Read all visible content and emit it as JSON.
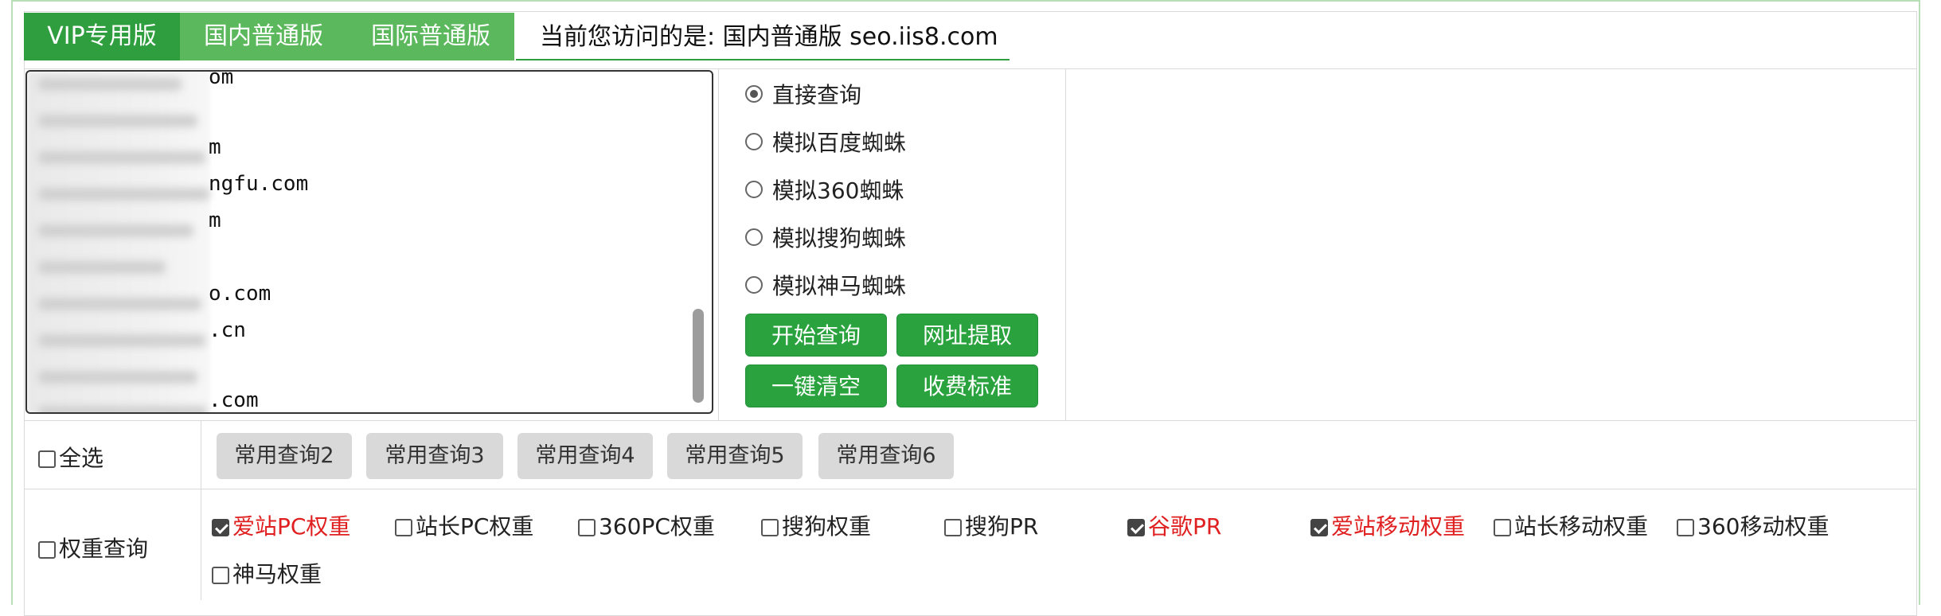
{
  "tabs": [
    {
      "label": "VIP专用版",
      "active": true
    },
    {
      "label": "国内普通版",
      "active": false
    },
    {
      "label": "国际普通版",
      "active": false
    }
  ],
  "visit_text": "当前您访问的是: 国内普通版 seo.iis8.com",
  "url_lines": [
    {
      "text": "om"
    },
    {
      "text": ""
    },
    {
      "text": "m"
    },
    {
      "text": "ngfu.com"
    },
    {
      "text": "m"
    },
    {
      "text": ""
    },
    {
      "text": "o.com"
    },
    {
      "text": ".cn"
    },
    {
      "text": ""
    },
    {
      "text": ".com"
    }
  ],
  "query_modes": [
    {
      "label": "直接查询",
      "checked": true
    },
    {
      "label": "模拟百度蜘蛛",
      "checked": false
    },
    {
      "label": "模拟360蜘蛛",
      "checked": false
    },
    {
      "label": "模拟搜狗蜘蛛",
      "checked": false
    },
    {
      "label": "模拟神马蜘蛛",
      "checked": false
    }
  ],
  "action_buttons": {
    "start": "开始查询",
    "extract": "网址提取",
    "clear": "一键清空",
    "pricing": "收费标准"
  },
  "select_all": {
    "label": "全选",
    "checked": false
  },
  "common_queries": [
    "常用查询2",
    "常用查询3",
    "常用查询4",
    "常用查询5",
    "常用查询6"
  ],
  "weight_query": {
    "label": "权重查询",
    "checked": false
  },
  "weight_items": [
    {
      "label": "爱站PC权重",
      "checked": true,
      "highlight": true
    },
    {
      "label": "站长PC权重",
      "checked": false,
      "highlight": false
    },
    {
      "label": "360PC权重",
      "checked": false,
      "highlight": false
    },
    {
      "label": "搜狗权重",
      "checked": false,
      "highlight": false
    },
    {
      "label": "搜狗PR",
      "checked": false,
      "highlight": false
    },
    {
      "label": "谷歌PR",
      "checked": true,
      "highlight": true
    },
    {
      "label": "爱站移动权重",
      "checked": true,
      "highlight": true
    },
    {
      "label": "站长移动权重",
      "checked": false,
      "highlight": false
    },
    {
      "label": "360移动权重",
      "checked": false,
      "highlight": false
    },
    {
      "label": "神马权重",
      "checked": false,
      "highlight": false
    }
  ],
  "colors": {
    "tab_active": "#2e9e3e",
    "tab_inactive": "#5cb85c",
    "button_green": "#2aa33f",
    "highlight_red": "#e02020"
  }
}
